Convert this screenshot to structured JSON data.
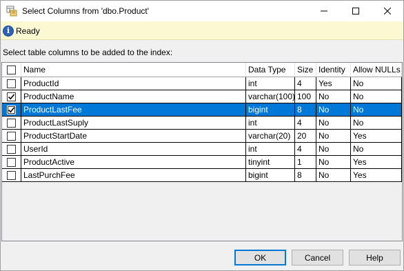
{
  "window": {
    "title": "Select Columns from 'dbo.Product'",
    "controls": {
      "minimize": "minimize-icon",
      "maximize": "maximize-icon",
      "close": "close-icon"
    }
  },
  "status": {
    "text": "Ready",
    "icon": "info-icon"
  },
  "instruction": "Select table columns to be added to the index:",
  "table": {
    "headers": {
      "name": "Name",
      "type": "Data Type",
      "size": "Size",
      "identity": "Identity",
      "nulls": "Allow NULLs"
    },
    "rows": [
      {
        "checked": false,
        "name": "ProductId",
        "type": "int",
        "size": "4",
        "identity": "Yes",
        "nulls": "No"
      },
      {
        "checked": true,
        "name": "ProductName",
        "type": "varchar(100)",
        "size": "100",
        "identity": "No",
        "nulls": "No"
      },
      {
        "checked": true,
        "selected": true,
        "name": "ProductLastFee",
        "type": "bigint",
        "size": "8",
        "identity": "No",
        "nulls": "No"
      },
      {
        "checked": false,
        "name": "ProductLastSuply",
        "type": "int",
        "size": "4",
        "identity": "No",
        "nulls": "No"
      },
      {
        "checked": false,
        "name": "ProductStartDate",
        "type": "varchar(20)",
        "size": "20",
        "identity": "No",
        "nulls": "Yes"
      },
      {
        "checked": false,
        "name": "UserId",
        "type": "int",
        "size": "4",
        "identity": "No",
        "nulls": "No"
      },
      {
        "checked": false,
        "name": "ProductActive",
        "type": "tinyint",
        "size": "1",
        "identity": "No",
        "nulls": "Yes"
      },
      {
        "checked": false,
        "name": "LastPurchFee",
        "type": "bigint",
        "size": "8",
        "identity": "No",
        "nulls": "Yes"
      }
    ]
  },
  "buttons": {
    "ok": "OK",
    "cancel": "Cancel",
    "help": "Help"
  },
  "colors": {
    "selection": "#0078d7",
    "status_bg": "#fbf9d2",
    "info": "#2d61b8"
  }
}
